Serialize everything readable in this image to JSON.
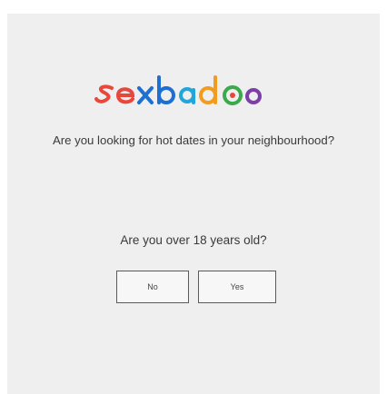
{
  "logo": {
    "text": "sexbadoo",
    "letters": [
      {
        "char": "s",
        "color": "#e8473c"
      },
      {
        "char": "e",
        "color": "#e8473c"
      },
      {
        "char": "x",
        "color": "#1d6fd1"
      },
      {
        "char": "b",
        "color": "#1d6fd1"
      },
      {
        "char": "a",
        "color": "#22a6d9"
      },
      {
        "char": "d",
        "color": "#f29c1f"
      },
      {
        "char": "o",
        "color": "#3aaa4a"
      },
      {
        "char": "o",
        "color": "#7c3fa8"
      }
    ]
  },
  "tagline": "Are you looking for hot dates in your neighbourhood?",
  "age_question": "Are you over 18 years old?",
  "buttons": {
    "no_label": "No",
    "yes_label": "Yes"
  }
}
